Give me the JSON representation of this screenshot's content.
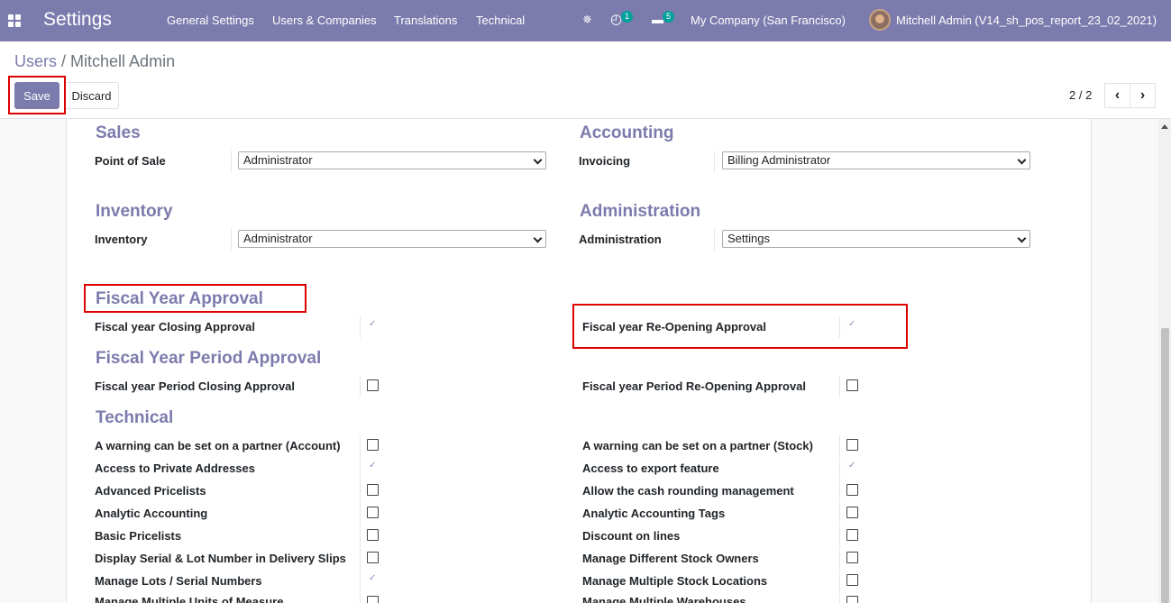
{
  "navbar": {
    "app_title": "Settings",
    "menus": [
      "General Settings",
      "Users & Companies",
      "Translations",
      "Technical"
    ],
    "activity_count": "1",
    "message_count": "5",
    "company": "My Company (San Francisco)",
    "user": "Mitchell Admin (V14_sh_pos_report_23_02_2021)",
    "bug_icon": "✵",
    "clock_icon": "◴",
    "chat_icon": "▬"
  },
  "breadcrumb": {
    "parent": "Users",
    "separator": "/",
    "current": "Mitchell Admin"
  },
  "toolbar": {
    "save_label": "Save",
    "discard_label": "Discard",
    "pager": "2 / 2",
    "prev_icon": "‹",
    "next_icon": "›"
  },
  "sections": {
    "sales": {
      "title": "Sales",
      "field_label": "Point of Sale",
      "value": "Administrator"
    },
    "accounting": {
      "title": "Accounting",
      "field_label": "Invoicing",
      "value": "Billing Administrator"
    },
    "inventory": {
      "title": "Inventory",
      "field_label": "Inventory",
      "value": "Administrator"
    },
    "administration": {
      "title": "Administration",
      "field_label": "Administration",
      "value": "Settings"
    },
    "fiscal_year": {
      "title": "Fiscal Year Approval",
      "left_label": "Fiscal year Closing Approval",
      "left_checked": true,
      "right_label": "Fiscal year Re-Opening Approval",
      "right_checked": true
    },
    "fiscal_period": {
      "title": "Fiscal Year Period Approval",
      "left_label": "Fiscal year Period Closing Approval",
      "left_checked": false,
      "right_label": "Fiscal year Period Re-Opening Approval",
      "right_checked": false
    },
    "technical": {
      "title": "Technical",
      "left": [
        {
          "label": "A warning can be set on a partner (Account)",
          "checked": false
        },
        {
          "label": "Access to Private Addresses",
          "checked": true
        },
        {
          "label": "Advanced Pricelists",
          "checked": false
        },
        {
          "label": "Analytic Accounting",
          "checked": false
        },
        {
          "label": "Basic Pricelists",
          "checked": false
        },
        {
          "label": "Display Serial & Lot Number in Delivery Slips",
          "checked": false
        },
        {
          "label": "Manage Lots / Serial Numbers",
          "checked": true
        },
        {
          "label": "Manage Multiple Units of Measure",
          "checked": false
        }
      ],
      "right": [
        {
          "label": "A warning can be set on a partner (Stock)",
          "checked": false
        },
        {
          "label": "Access to export feature",
          "checked": true
        },
        {
          "label": "Allow the cash rounding management",
          "checked": false
        },
        {
          "label": "Analytic Accounting Tags",
          "checked": false
        },
        {
          "label": "Discount on lines",
          "checked": false
        },
        {
          "label": "Manage Different Stock Owners",
          "checked": false
        },
        {
          "label": "Manage Multiple Stock Locations",
          "checked": false
        },
        {
          "label": "Manage Multiple Warehouses",
          "checked": false
        }
      ]
    }
  },
  "colors": {
    "brand": "#7c7bad",
    "highlight": "#dd0000"
  }
}
